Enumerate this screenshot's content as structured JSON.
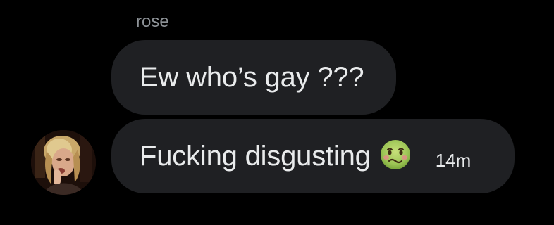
{
  "sender": {
    "name": "rose"
  },
  "messages": [
    {
      "text": "Ew who’s gay ???"
    },
    {
      "text": "Fucking disgusting",
      "emoji": "nauseated-face-icon",
      "timestamp": "14m"
    }
  ],
  "colors": {
    "background": "#000000",
    "bubble": "#1f2023",
    "text": "#e9ebec",
    "sender_name": "#8e9398"
  }
}
